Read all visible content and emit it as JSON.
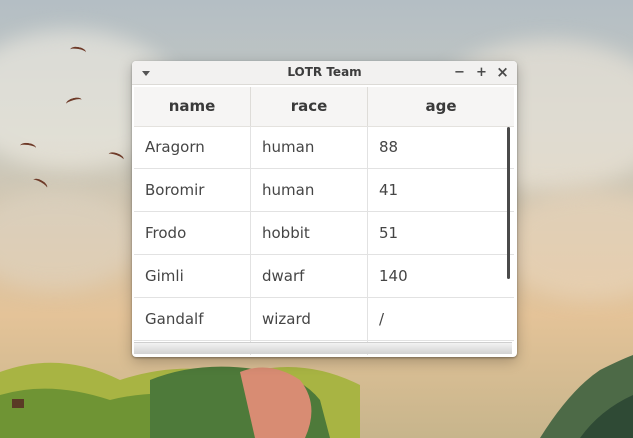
{
  "window": {
    "title": "LOTR Team",
    "menu_icon": "triangle-down-icon",
    "minimize_label": "−",
    "maximize_label": "+",
    "close_label": "×"
  },
  "table": {
    "columns": [
      "name",
      "race",
      "age"
    ],
    "rows": [
      [
        "Aragorn",
        "human",
        "88"
      ],
      [
        "Boromir",
        "human",
        "41"
      ],
      [
        "Frodo",
        "hobbit",
        "51"
      ],
      [
        "Gimli",
        "dwarf",
        "140"
      ],
      [
        "Gandalf",
        "wizard",
        "/"
      ],
      [
        "",
        "",
        ""
      ]
    ]
  },
  "colors": {
    "titlebar": "#f2f1f0",
    "header_bg": "#f6f5f4",
    "text": "#454545",
    "scrollbar": "#4a4a4a"
  }
}
